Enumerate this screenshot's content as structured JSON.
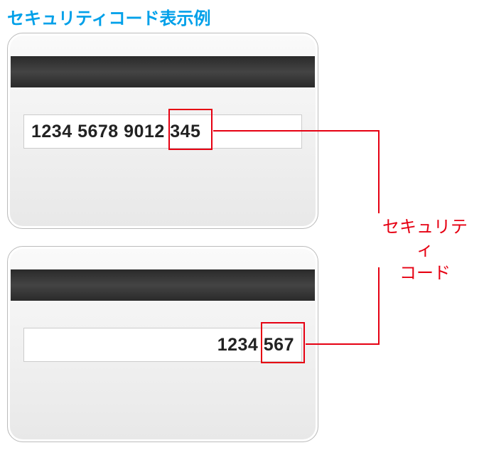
{
  "title": "セキュリティコード表示例",
  "callout": {
    "line1": "セキュリティ",
    "line2": "コード"
  },
  "colors": {
    "accent_blue": "#00a0e9",
    "accent_red": "#e60012"
  },
  "cards": [
    {
      "id": "card1",
      "signature_panel": {
        "align": "left",
        "groups": [
          "1234",
          "5678",
          "9012",
          "345"
        ],
        "security_code_group_index": 3
      }
    },
    {
      "id": "card2",
      "signature_panel": {
        "align": "right",
        "groups": [
          "1234",
          "567"
        ],
        "security_code_group_index": 1
      }
    }
  ]
}
